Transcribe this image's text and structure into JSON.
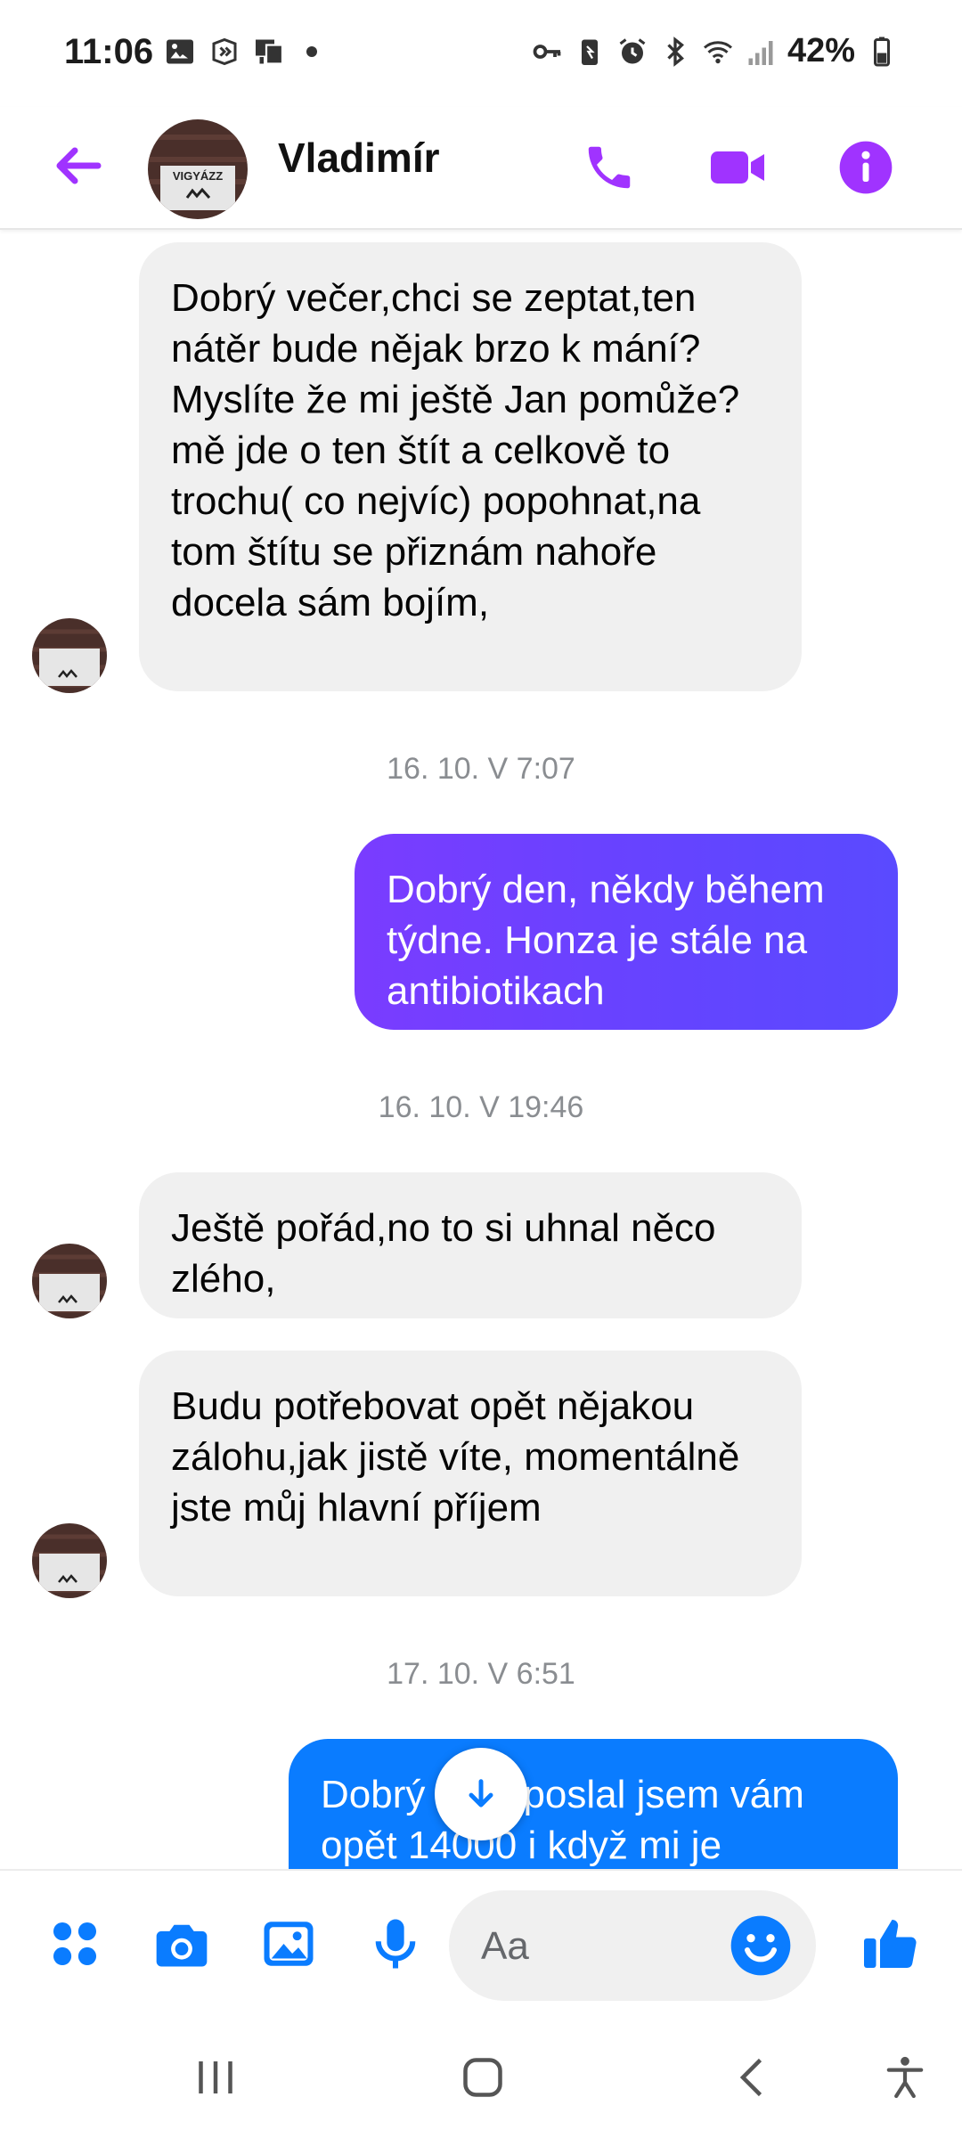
{
  "status_bar": {
    "time": "11:06",
    "battery": "42%",
    "left_icons": [
      "gallery-icon",
      "shazam-icon",
      "presentation-icon",
      "dot-icon"
    ],
    "right_icons": [
      "vpn-key-icon",
      "battery-saver-icon",
      "alarm-icon",
      "bluetooth-icon",
      "wifi-icon",
      "signal-icon",
      "battery-icon"
    ]
  },
  "header": {
    "contact_name": "Vladimír",
    "avatar_text": "VIGYÁZZ",
    "accent_color": "#a033ff"
  },
  "messages": [
    {
      "type": "incoming",
      "text": "Dobrý večer,chci se zeptat,ten nátěr bude nějak brzo k mání? Myslíte že mi ještě Jan pomůže?mě jde o ten štít a celkově to trochu( co nejvíc) popohnat,na tom štítu se přiznám nahoře docela sám bojím,"
    },
    {
      "type": "timestamp",
      "text": "16. 10. V 7:07"
    },
    {
      "type": "outgoing",
      "text": "Dobrý den,  někdy během týdne. Honza je stále na antibiotikach"
    },
    {
      "type": "timestamp",
      "text": "16. 10. V 19:46"
    },
    {
      "type": "incoming",
      "text": "Ještě pořád,no to si uhnal něco zlého,"
    },
    {
      "type": "incoming",
      "text": "Budu potřebovat opět nějakou zálohu,jak jistě víte, momentálně jste můj hlavní příjem"
    },
    {
      "type": "timestamp",
      "text": "17. 10. V 6:51"
    },
    {
      "type": "outgoing",
      "text": "Dobrý den, poslal jsem vám opět 14000 i když mi je"
    }
  ],
  "composer": {
    "placeholder": "Aa"
  },
  "colors": {
    "incoming_bubble": "#f0f0f0",
    "outgoing_gradient_purple": "#6440ff",
    "outgoing_blue": "#0a7cff",
    "composer_icon": "#0a7cff"
  }
}
